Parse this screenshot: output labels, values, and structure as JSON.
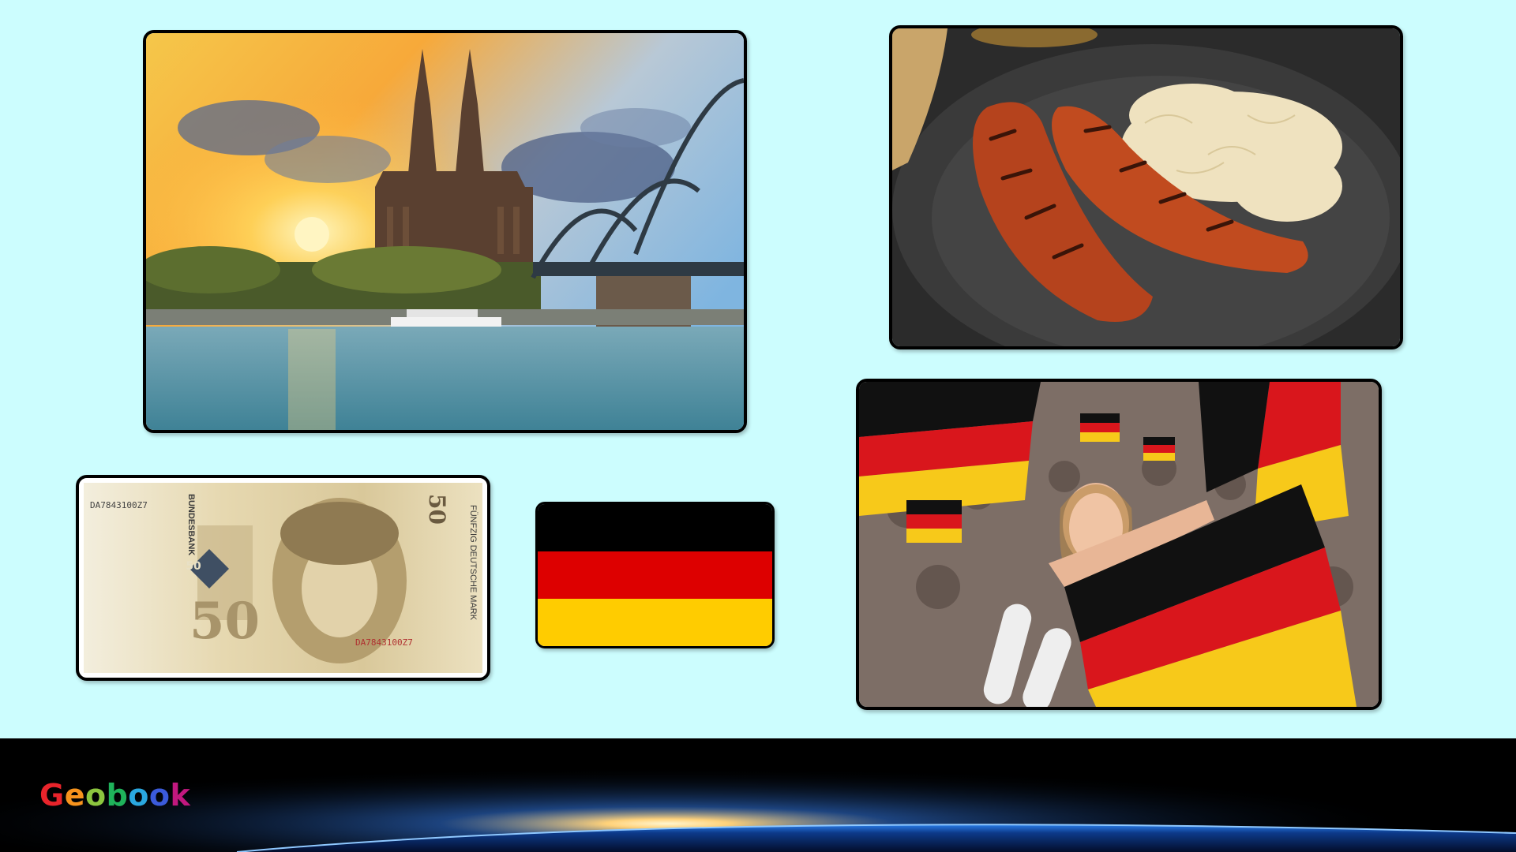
{
  "slide": {
    "background_color": "#ccfdfe",
    "images": [
      {
        "name": "cologne-cathedral-photo",
        "subject": "Cologne Cathedral and Hohenzollern Bridge over the Rhine at sunset"
      },
      {
        "name": "sausage-sauerkraut-photo",
        "subject": "grilled sausages with sauerkraut on slate plate"
      },
      {
        "name": "deutsche-mark-banknote",
        "subject": "50 Deutsche Mark banknote"
      },
      {
        "name": "german-flag",
        "subject": "flag of Germany"
      },
      {
        "name": "football-fans-photo",
        "subject": "fans waving German flags"
      }
    ]
  },
  "banknote": {
    "serial": "DA7843100Z7",
    "serial_bottom": "DA7843100Z7",
    "denomination": "50",
    "side_text": "FÜNFZIG DEUTSCHE MARK",
    "bank_text": "BUNDESBANK"
  },
  "flag": {
    "colors": [
      "#000000",
      "#dd0000",
      "#ffcc00"
    ]
  },
  "footer": {
    "logo_letters": [
      "G",
      "e",
      "o",
      "b",
      "o",
      "o",
      "k"
    ],
    "logo_colors": [
      "#e8242b",
      "#f7931d",
      "#8cc63f",
      "#1fb35b",
      "#2aa8e0",
      "#3b5bdb",
      "#c2187f"
    ]
  }
}
